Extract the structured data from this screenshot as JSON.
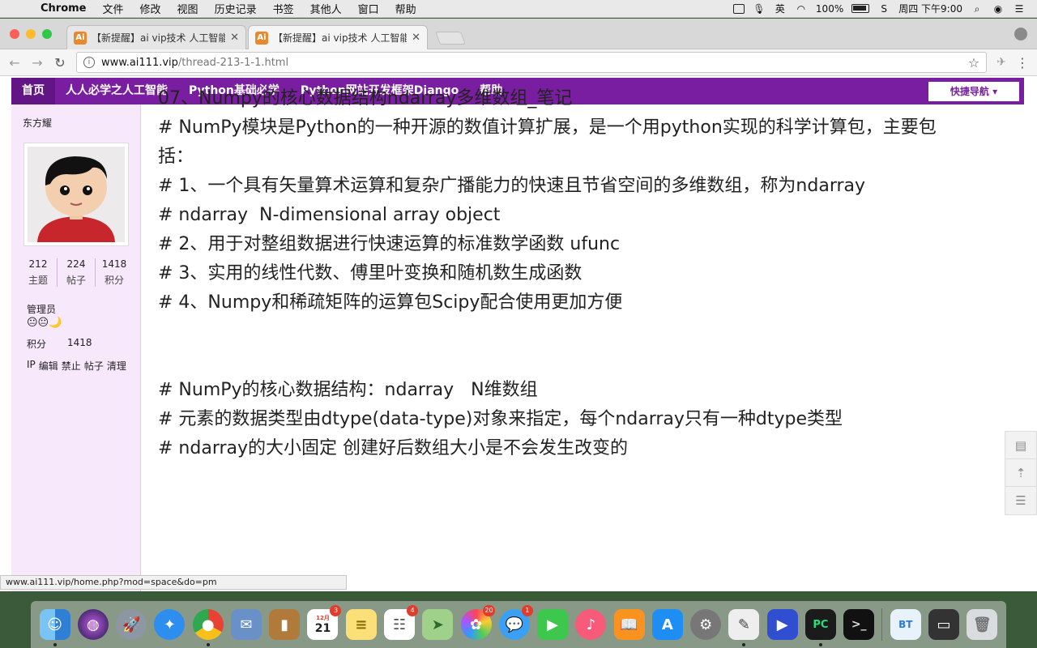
{
  "menubar": {
    "app_name": "Chrome",
    "items": [
      "文件",
      "修改",
      "视图",
      "历史记录",
      "书签",
      "其他人",
      "窗口",
      "帮助"
    ],
    "input_method": "英",
    "battery": "100%",
    "clock": "周四 下午9:00"
  },
  "tabs": [
    {
      "title": "【新提醒】ai vip技术 人工智能",
      "favicon": "Ai"
    },
    {
      "title": "【新提醒】ai vip技术 人工智能",
      "favicon": "Ai"
    }
  ],
  "address": {
    "host": "www.ai111.vip",
    "path": "/thread-213-1-1.html"
  },
  "sitenav": {
    "items": [
      "首页",
      "人人必学之人工智能",
      "Python基础必学",
      "Python网站开发框架Django",
      "帮助"
    ],
    "quick_nav": "快捷导航"
  },
  "user": {
    "name": "东方耀",
    "stats": [
      {
        "value": "212",
        "label": "主题"
      },
      {
        "value": "224",
        "label": "帖子"
      },
      {
        "value": "1418",
        "label": "积分"
      }
    ],
    "role": "管理员",
    "emoji": "😐😐🌙",
    "points_label": "积分",
    "points_value": "1418",
    "actions": [
      "IP",
      "编辑",
      "禁止",
      "帖子",
      "清理"
    ]
  },
  "content": {
    "lines": [
      "07、Numpy的核心数据结构ndarray多维数组_笔记",
      "# NumPy模块是Python的一种开源的数值计算扩展，是一个用python实现的科学计算包，主要包",
      "括：",
      "# 1、一个具有矢量算术运算和复杂广播能力的快速且节省空间的多维数组，称为ndarray",
      "# ndarray  N-dimensional array object",
      "# 2、用于对整组数据进行快速运算的标准数学函数 ufunc",
      "# 3、实用的线性代数、傅里叶变换和随机数生成函数",
      "# 4、Numpy和稀疏矩阵的运算包Scipy配合使用更加方便"
    ],
    "lines2": [
      "# NumPy的核心数据结构：ndarray   N维数组",
      "# 元素的数据类型由dtype(data-type)对象来指定，每个ndarray只有一种dtype类型",
      "# ndarray的大小固定 创建好后数组大小是不会发生改变的"
    ]
  },
  "status_url": "www.ai111.vip/home.php?mod=space&do=pm",
  "dock": {
    "calendar_month": "12月",
    "calendar_day": "21",
    "badges": {
      "calendar": "3",
      "reminders": "4",
      "photos": "20",
      "messages": "1"
    },
    "bt_label": "BT",
    "pc_label": "PC"
  }
}
